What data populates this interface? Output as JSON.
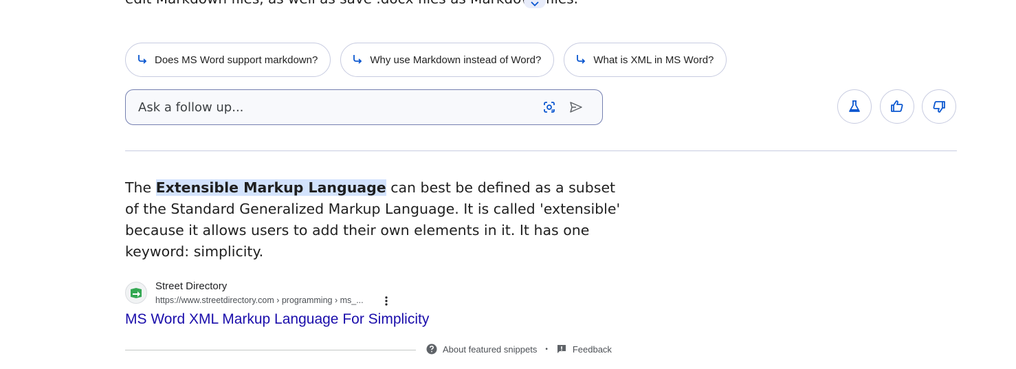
{
  "previous_answer": {
    "clipped_text": "edit Markdown files, as well as save .docx files as Markdown files."
  },
  "suggestions": [
    {
      "label": "Does MS Word support markdown?"
    },
    {
      "label": "Why use Markdown instead of Word?"
    },
    {
      "label": "What is XML in MS Word?"
    }
  ],
  "ask_box": {
    "placeholder": "Ask a follow up...",
    "value": ""
  },
  "featured_snippet": {
    "text_before": "The ",
    "highlight": "Extensible Markup Language",
    "text_after": " can best be defined as a subset of the Standard Generalized Markup Language. It is called 'extensible' because it allows users to add their own elements in it. It has one keyword: simplicity."
  },
  "source": {
    "name": "Street Directory",
    "url": "https://www.streetdirectory.com › programming › ms_...",
    "title": "MS Word XML Markup Language For Simplicity"
  },
  "footer": {
    "about_label": "About featured snippets",
    "separator": "•",
    "feedback_label": "Feedback"
  },
  "colors": {
    "accent": "#0b57d0",
    "link": "#1a0dab",
    "highlight": "#d3e3fd"
  },
  "icons": [
    "suggestion-arrow-icon",
    "google-lens-icon",
    "send-icon",
    "labs-flask-icon",
    "thumbs-up-icon",
    "thumbs-down-icon",
    "more-vert-icon",
    "help-icon",
    "feedback-icon",
    "chevron-down-icon"
  ]
}
